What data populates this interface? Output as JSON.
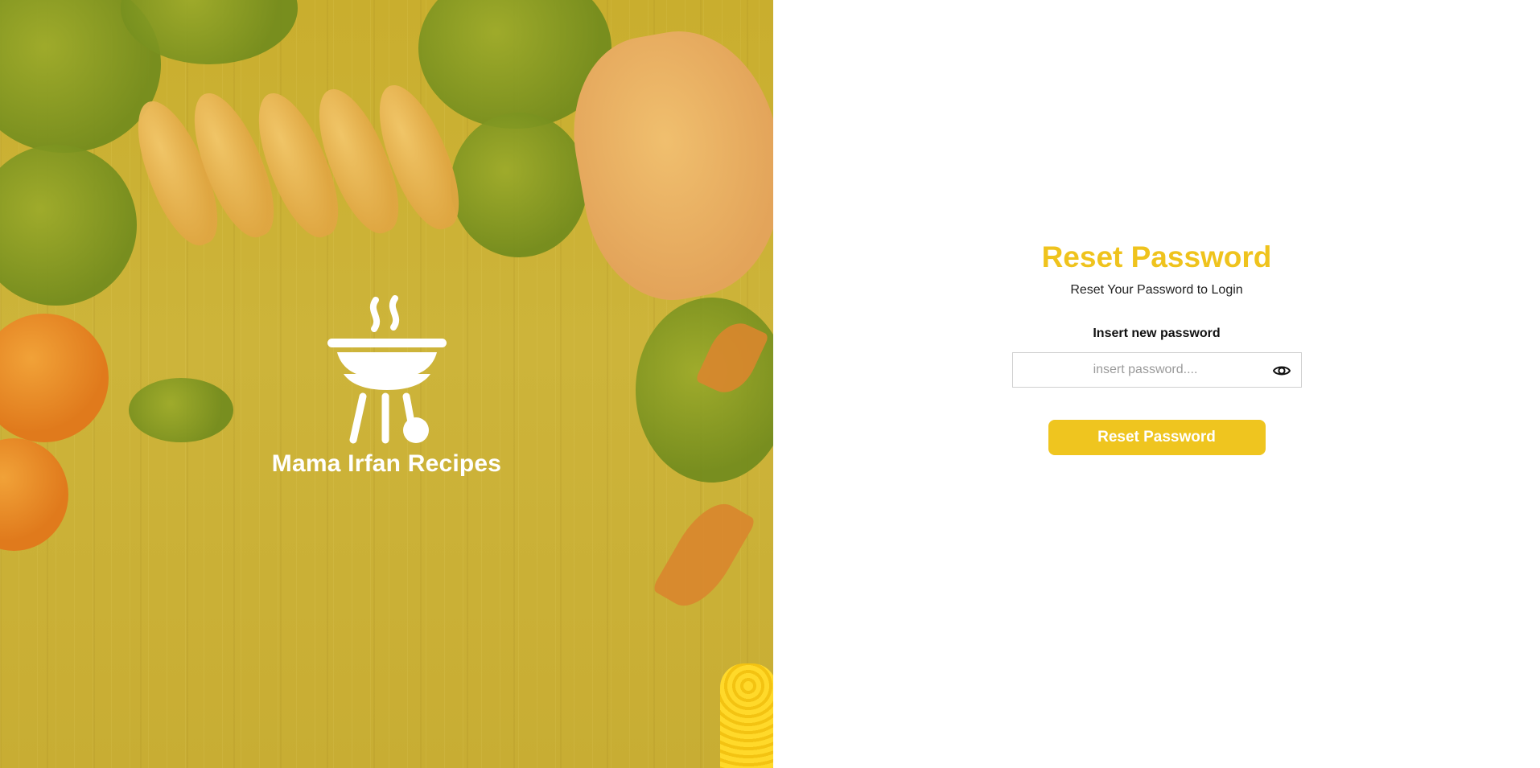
{
  "hero": {
    "brand_name": "Mama Irfan Recipes",
    "logo_icon": "grill-bbq-icon",
    "overlay_color": "#c9ae2e"
  },
  "form": {
    "title": "Reset Password",
    "subtitle": "Reset Your Password to Login",
    "field_label": "Insert new password",
    "password_placeholder": "insert password....",
    "password_value": "",
    "toggle_icon": "eye-icon",
    "submit_label": "Reset Password"
  },
  "colors": {
    "accent": "#efc31d",
    "button": "#efc51f",
    "text_dark": "#222222"
  }
}
